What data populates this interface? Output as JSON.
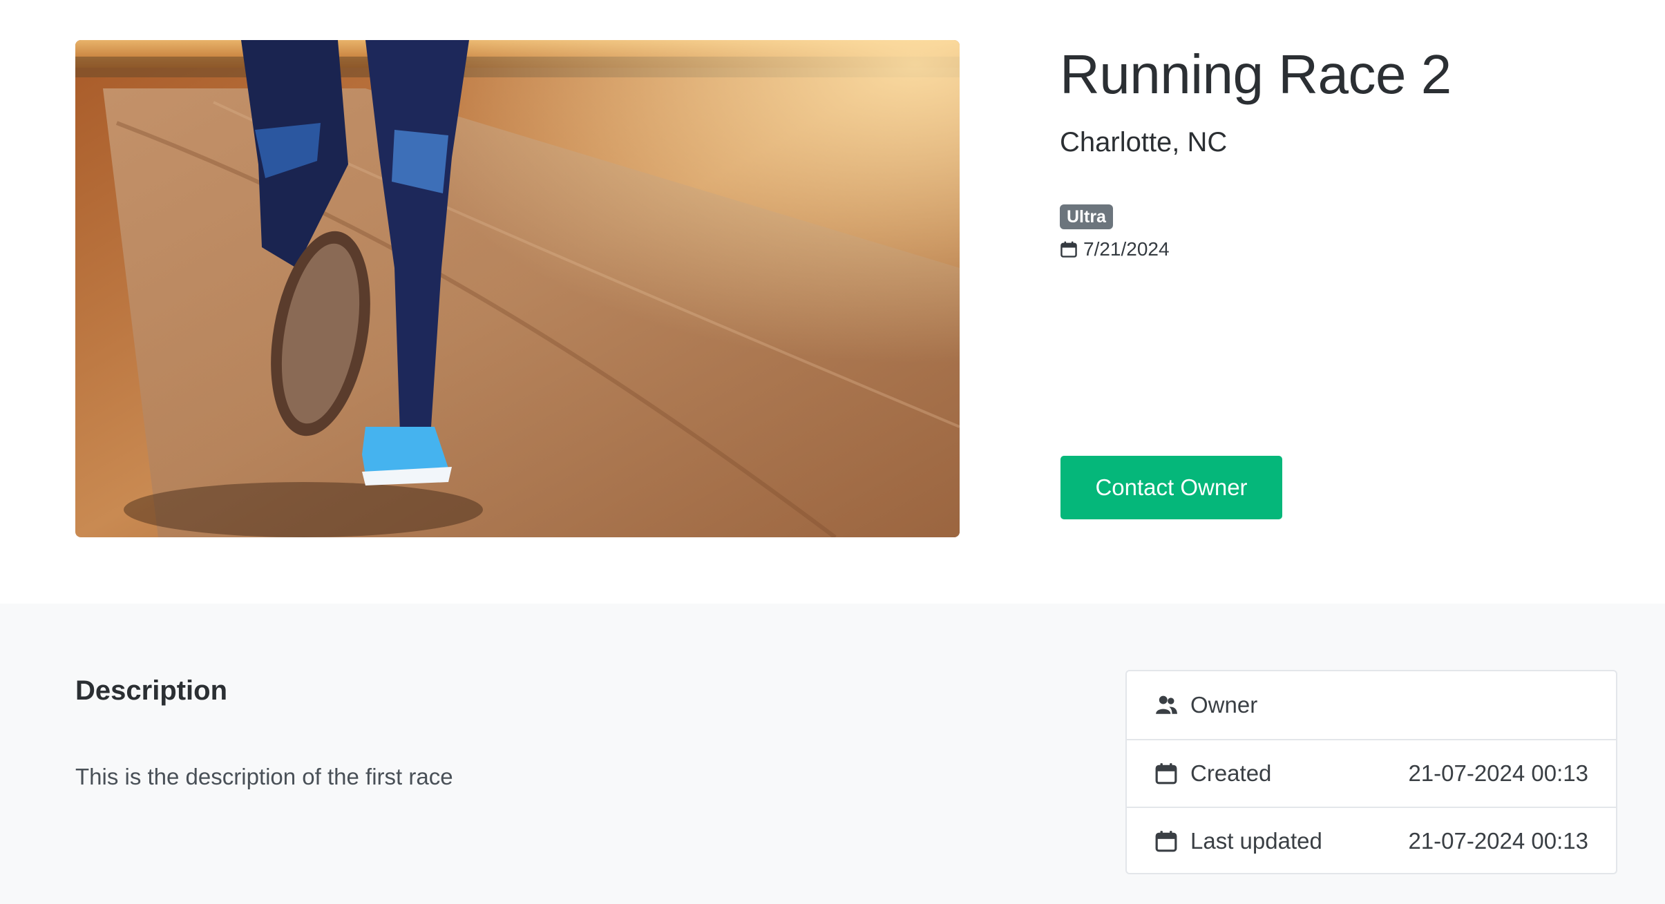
{
  "race": {
    "title": "Running Race 2",
    "location": "Charlotte, NC",
    "tag": "Ultra",
    "date": "7/21/2024",
    "contact_label": "Contact Owner"
  },
  "description": {
    "heading": "Description",
    "text": "This is the description of the first race"
  },
  "meta": {
    "owner_label": "Owner",
    "created_label": "Created",
    "created_value": "21-07-2024 00:13",
    "updated_label": "Last updated",
    "updated_value": "21-07-2024 00:13"
  },
  "icons": {
    "calendar": "calendar-icon",
    "users": "users-icon"
  },
  "colors": {
    "accent": "#05b77a",
    "badge": "#6c757d",
    "section_bg": "#f8f9fa"
  }
}
